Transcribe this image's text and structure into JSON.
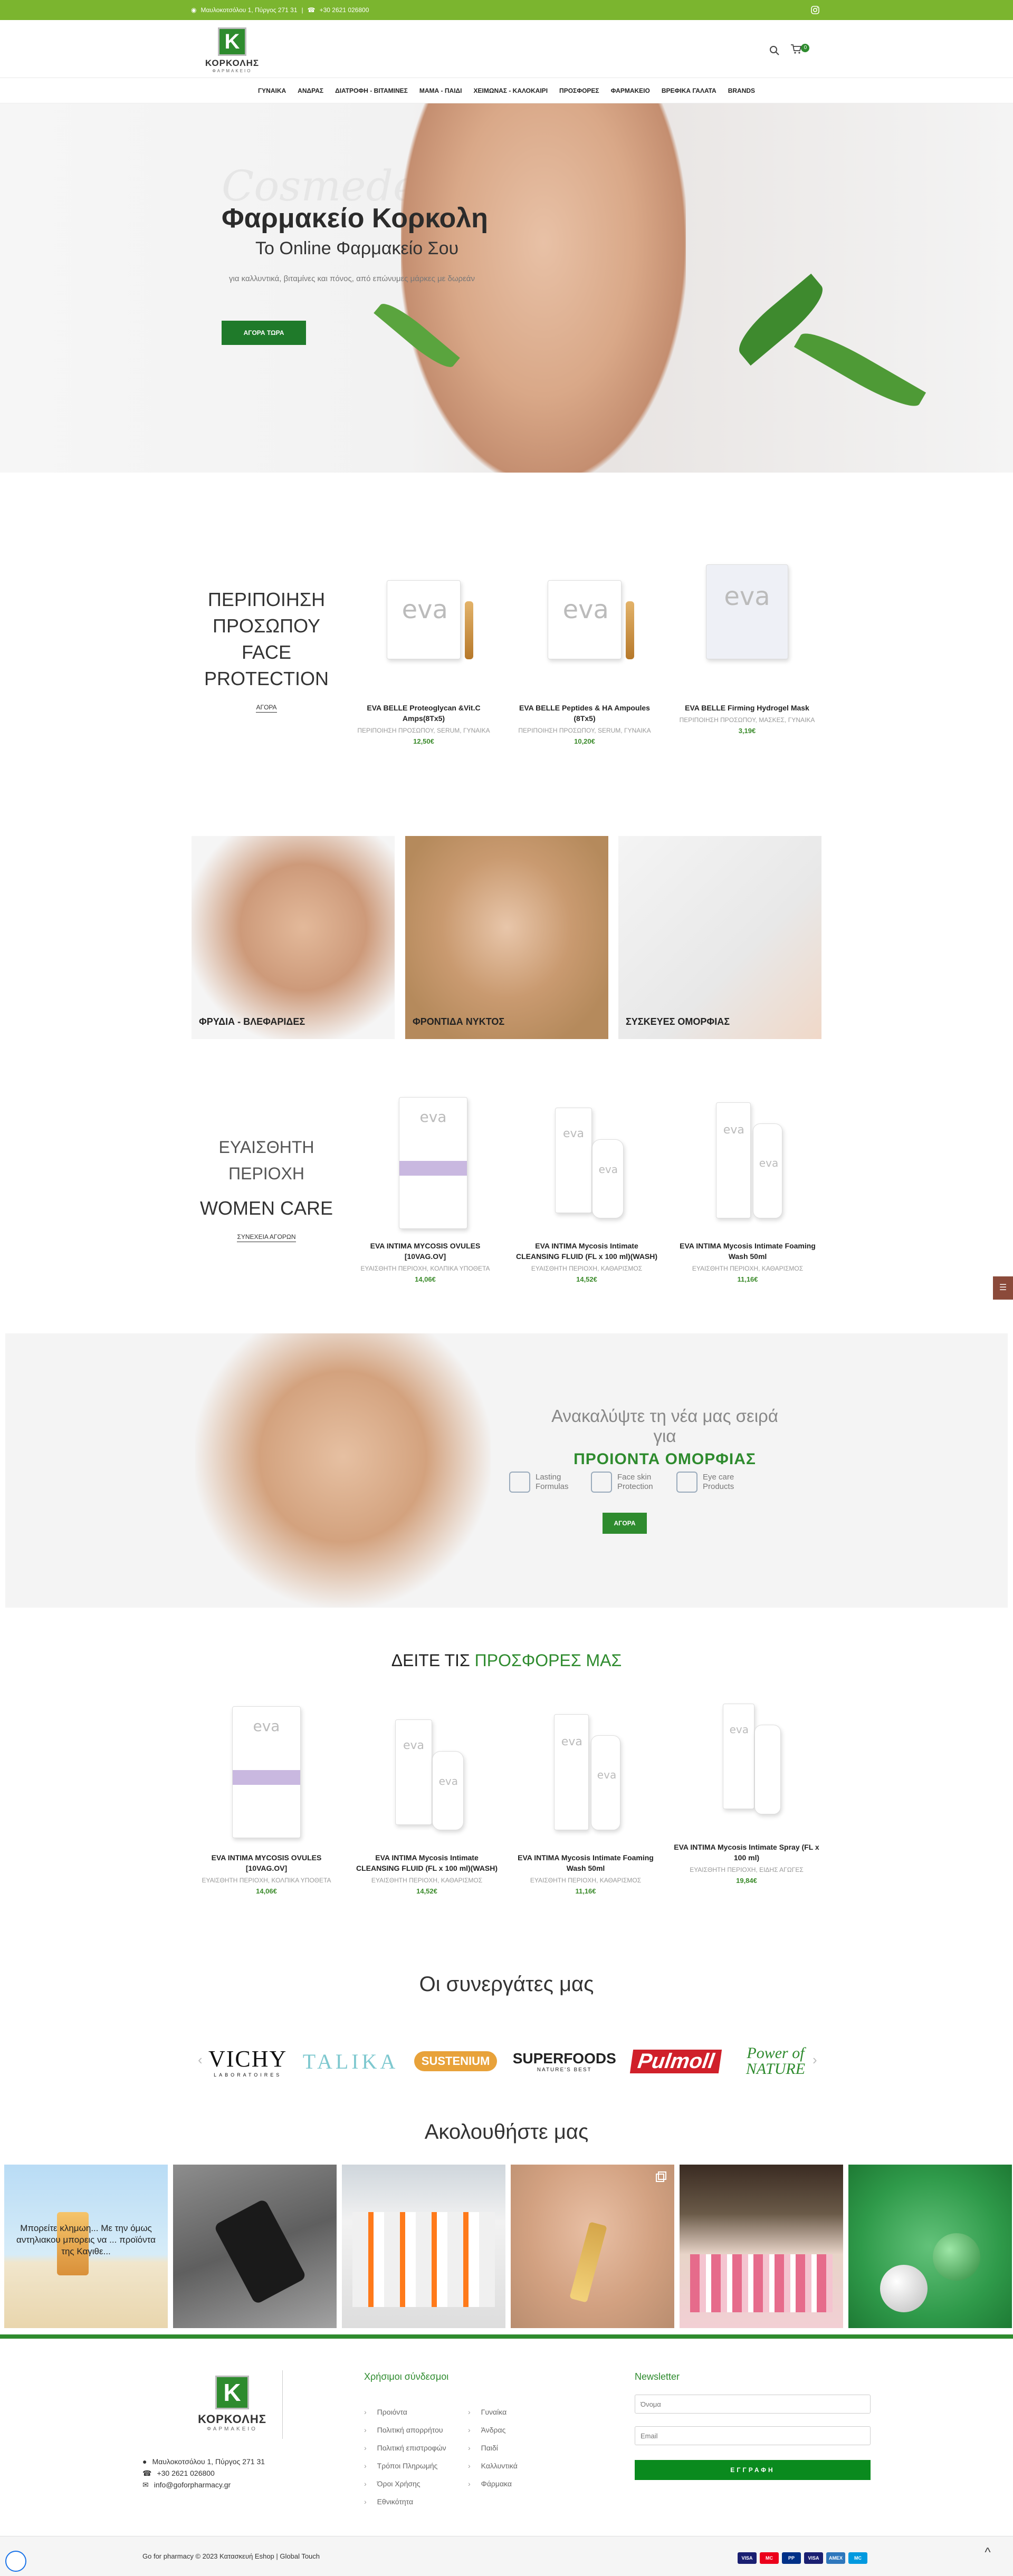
{
  "topbar": {
    "address": "Μαυλοκοτσόλου 1, Πύργος 271 31",
    "separator": "|",
    "phone": "+30 2621 026800"
  },
  "header": {
    "logo_name": "ΚΟΡΚΟΛΗΣ",
    "logo_sub": "ΦΑΡΜΑΚΕΙΟ",
    "cart_count": "0"
  },
  "nav": [
    "ΓΥΝΑΙΚΑ",
    "ΑΝΔΡΑΣ",
    "ΔΙΑΤΡΟΦΗ - ΒΙΤΑΜΙΝΕΣ",
    "ΜΑΜΑ - ΠΑΙΔΙ",
    "ΧΕΙΜΩΝΑΣ - ΚΑΛΟΚΑΙΡΙ",
    "ΠΡΟΣΦΟΡΕΣ",
    "ΦΑΡΜΑΚΕΙΟ",
    "ΒΡΕΦΙΚΑ ΓΑΛΑΤΑ",
    "BRANDS"
  ],
  "hero": {
    "ghost": "Cosmede",
    "title": "Φαρμακείο Κορκολη",
    "subtitle": "Το Online Φαρμακείο Σου",
    "text": "για καλλυντικά, βιταμίνες και πόνος, από επώνυμες μάρκες με δωρεάν",
    "button": "ΑΓΟΡΑ ΤΩΡΑ"
  },
  "face": {
    "title1": "ΠΕΡΙΠΟΙΗΣΗ",
    "title2": "ΠΡΟΣΩΠΟΥ",
    "title3": "FACE",
    "title4": "PROTECTION",
    "link": "ΑΓΟΡΑ",
    "products": [
      {
        "name": "EVA BELLE Proteoglycan &Vit.C Amps(8Tx5)",
        "cat": "ΠΕΡΙΠΟΙΗΣΗ ΠΡΟΣΩΠΟΥ, SERUM, ΓΥΝΑΙΚΑ",
        "price": "12,50€"
      },
      {
        "name": "EVA BELLE Peptides & HA Ampoules (8Tx5)",
        "cat": "ΠΕΡΙΠΟΙΗΣΗ ΠΡΟΣΩΠΟΥ, SERUM, ΓΥΝΑΙΚΑ",
        "price": "10,20€"
      },
      {
        "name": "EVA BELLE Firming Hydrogel Mask",
        "cat": "ΠΕΡΙΠΟΙΗΣΗ ΠΡΟΣΩΠΟΥ, ΜΑΣΚΕΣ, ΓΥΝΑΙΚΑ",
        "price": "3,19€"
      }
    ]
  },
  "tiles": [
    "ΦΡΥΔΙΑ - ΒΛΕΦΑΡΙΔΕΣ",
    "ΦΡΟΝΤΙΔΑ ΝΥΚΤΟΣ",
    "ΣΥΣΚΕΥΕΣ ΟΜΟΡΦΙΑΣ"
  ],
  "women": {
    "title1": "ΕΥΑΙΣΘΗΤΗ",
    "title2": "ΠΕΡΙΟΧΗ",
    "title3": "WOMEN CARE",
    "link": "ΣΥΝΕΧΕΙΑ ΑΓΟΡΩΝ",
    "products": [
      {
        "name": "EVA INTIMA MYCOSIS OVULES [10VAG.OV]",
        "cat": "ΕΥΑΙΣΘΗΤΗ ΠΕΡΙΟΧΗ, ΚΟΛΠΙΚΑ ΥΠΟΘΕΤΑ",
        "price": "14,06€"
      },
      {
        "name": "EVA INTIMA Mycosis Intimate CLEANSING FLUID (FL x 100 ml)(WASH)",
        "cat": "ΕΥΑΙΣΘΗΤΗ ΠΕΡΙΟΧΗ, ΚΑΘΑΡΙΣΜΟΣ",
        "price": "14,52€"
      },
      {
        "name": "EVA INTIMA Mycosis Intimate Foaming Wash 50ml",
        "cat": "ΕΥΑΙΣΘΗΤΗ ΠΕΡΙΟΧΗ, ΚΑΘΑΡΙΣΜΟΣ",
        "price": "11,16€"
      }
    ]
  },
  "banner": {
    "line1": "Ανακαλύψτε τη νέα μας σειρά για",
    "line2": "ΠΡΟΙΟΝΤΑ ΟΜΟΡΦΙΑΣ",
    "feat1": "Lasting Formulas",
    "feat2": "Face skin Protection",
    "feat3": "Eye care Products",
    "button": "ΑΓΟΡΑ"
  },
  "offers": {
    "title_a": "ΔΕΙΤΕ ΤΙΣ",
    "title_b": "ΠΡΟΣΦΟΡΕΣ ΜΑΣ",
    "products": [
      {
        "name": "EVA INTIMA MYCOSIS OVULES [10VAG.OV]",
        "cat": "ΕΥΑΙΣΘΗΤΗ ΠΕΡΙΟΧΗ, ΚΟΛΠΙΚΑ ΥΠΟΘΕΤΑ",
        "price": "14,06€"
      },
      {
        "name": "EVA INTIMA Mycosis Intimate CLEANSING FLUID (FL x 100 ml)(WASH)",
        "cat": "ΕΥΑΙΣΘΗΤΗ ΠΕΡΙΟΧΗ, ΚΑΘΑΡΙΣΜΟΣ",
        "price": "14,52€"
      },
      {
        "name": "EVA INTIMA Mycosis Intimate Foaming Wash 50ml",
        "cat": "ΕΥΑΙΣΘΗΤΗ ΠΕΡΙΟΧΗ, ΚΑΘΑΡΙΣΜΟΣ",
        "price": "11,16€"
      },
      {
        "name": "EVA INTIMA Mycosis Intimate Spray (FL x 100 ml)",
        "cat": "ΕΥΑΙΣΘΗΤΗ ΠΕΡΙΟΧΗ, ΕΙΔΗΣ ΑΓΩΓΕΣ",
        "price": "19,84€"
      }
    ]
  },
  "partners": {
    "title": "Οι συνεργάτες μας",
    "logos": [
      "VICHY",
      "TALIKA",
      "SUSTENIUM",
      "SUPERFOODS",
      "Pulmoll",
      "Power of NATURE"
    ],
    "vichy_sub": "LABORATOIRES",
    "superfoods_sub": "NATURE'S BEST"
  },
  "follow": {
    "title": "Ακολουθήστε μας",
    "post1_text": "Μπορείτε κλημωη... Με την όμως αντηλιακου μπορεις να ... προϊόντα της Καγιθε..."
  },
  "footer": {
    "address": "Μαυλοκοτσόλου 1, Πύργος 271 31",
    "phone": "+30 2621 026800",
    "email": "info@goforpharmacy.gr",
    "links_title": "Χρήσιμοι σύνδεσμοι",
    "links_col1": [
      "Προιόντα",
      "Πολιτική απορρήτου",
      "Πολιτική επιστροφών",
      "Τρόποι Πληρωμής",
      "Όροι Χρήσης",
      "Εθνικότητα"
    ],
    "links_col2": [
      "Γυναίκα",
      "Άνδρας",
      "Παιδί",
      "Καλλυντικά",
      "Φάρμακα"
    ],
    "newsletter_title": "Newsletter",
    "name_placeholder": "Όνομα",
    "email_placeholder": "Email",
    "subscribe": "ΕΓΓΡΑΦΗ",
    "copyright": "Go for pharmacy © 2023 Κατασκευή Eshop | Global Touch",
    "payments": [
      "VISA",
      "MC",
      "PP",
      "VISA",
      "AMEX",
      "MC"
    ]
  },
  "colors": {
    "accent": "#2e8b2e",
    "topbar": "#7bb52f",
    "price": "#3a8a2a"
  }
}
